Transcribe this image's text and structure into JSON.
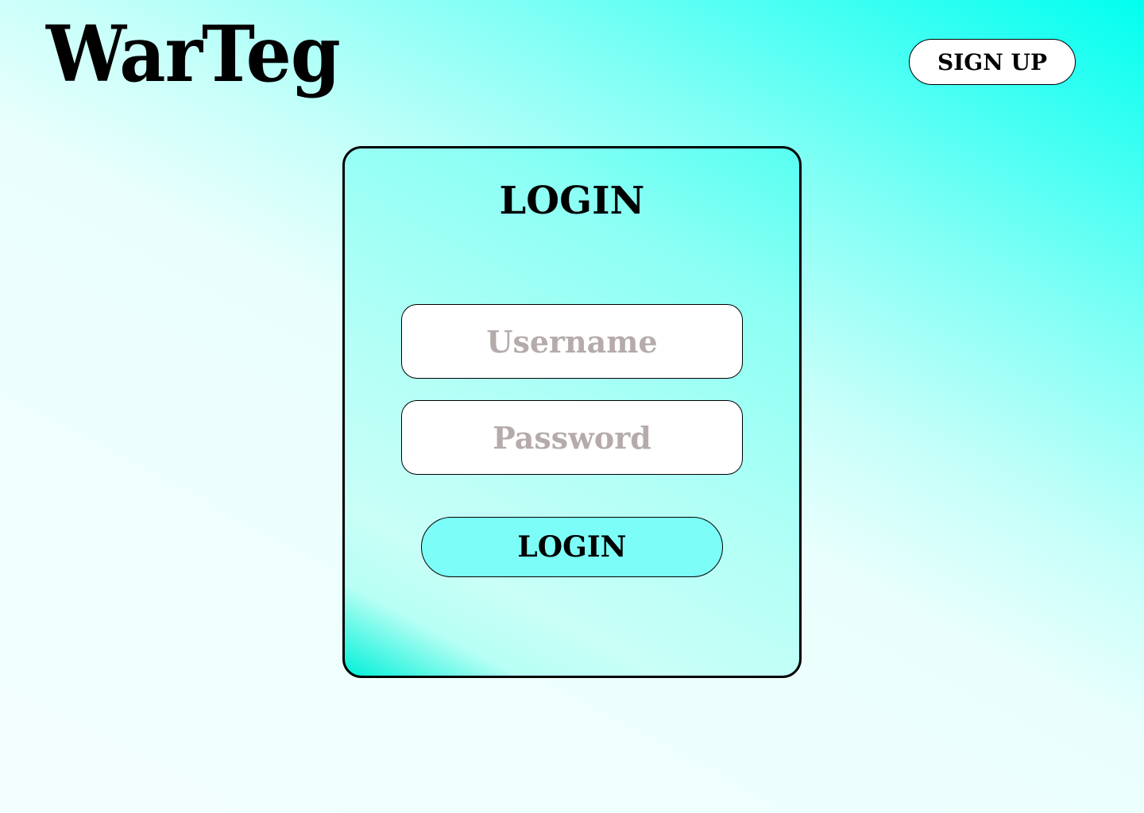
{
  "header": {
    "logo_text": "WarTeg",
    "signup_label": "SIGN UP"
  },
  "login_card": {
    "title": "LOGIN",
    "username": {
      "value": "",
      "placeholder": "Username"
    },
    "password": {
      "value": "",
      "placeholder": "Password"
    },
    "submit_label": "LOGIN"
  },
  "colors": {
    "background_accent": "#00fff0",
    "button_fill": "#7dfdf8",
    "placeholder_text": "#b5abab",
    "border": "#000000"
  }
}
